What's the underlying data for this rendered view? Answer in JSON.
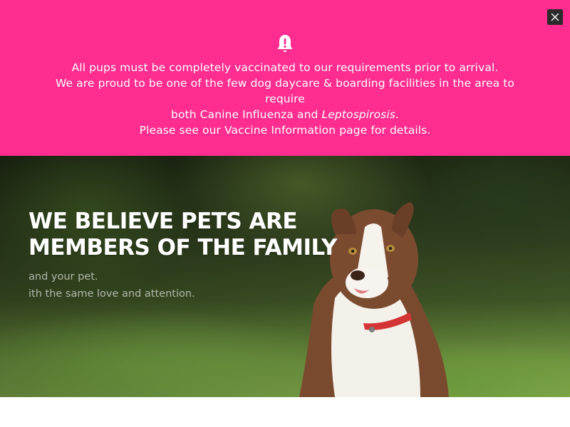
{
  "alert": {
    "icon": "bell-exclamation-icon",
    "lines": {
      "line1": "All pups must be completely vaccinated to our requirements prior to arrival.",
      "line2": "We are proud to be one of the few dog daycare & boarding facilities in the area to require",
      "line3_prefix": "both Canine Influenza and ",
      "line3_italic": "Leptospirosis",
      "line3_suffix": ".",
      "line4": "Please see our Vaccine Information page for details."
    },
    "close_icon": "close-icon",
    "colors": {
      "background": "#ff2d8f",
      "text": "#ffffff",
      "close_bg": "#2b2b2b"
    }
  },
  "hero": {
    "heading_line1": "WE BELIEVE PETS ARE",
    "heading_line2": "MEMBERS OF THE FAMILY",
    "sub_line1": "and your pet.",
    "sub_line2": "ith the same love and attention.",
    "image": "border-collie-puppy-photo"
  }
}
